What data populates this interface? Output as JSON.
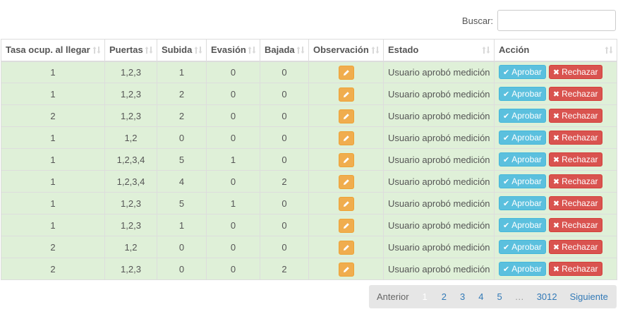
{
  "search": {
    "label": "Buscar:",
    "value": "",
    "placeholder": ""
  },
  "table": {
    "headers": [
      "Tasa ocup. al llegar",
      "Puertas",
      "Subida",
      "Evasión",
      "Bajada",
      "Observación",
      "Estado",
      "Acción"
    ],
    "actions": {
      "approve": "Aprobar",
      "reject": "Rechazar"
    },
    "rows": [
      {
        "tasa": "1",
        "puertas": "1,2,3",
        "subida": "1",
        "evasion": "0",
        "bajada": "0",
        "estado": "Usuario aprobó medición"
      },
      {
        "tasa": "1",
        "puertas": "1,2,3",
        "subida": "2",
        "evasion": "0",
        "bajada": "0",
        "estado": "Usuario aprobó medición"
      },
      {
        "tasa": "2",
        "puertas": "1,2,3",
        "subida": "2",
        "evasion": "0",
        "bajada": "0",
        "estado": "Usuario aprobó medición"
      },
      {
        "tasa": "1",
        "puertas": "1,2",
        "subida": "0",
        "evasion": "0",
        "bajada": "0",
        "estado": "Usuario aprobó medición"
      },
      {
        "tasa": "1",
        "puertas": "1,2,3,4",
        "subida": "5",
        "evasion": "1",
        "bajada": "0",
        "estado": "Usuario aprobó medición"
      },
      {
        "tasa": "1",
        "puertas": "1,2,3,4",
        "subida": "4",
        "evasion": "0",
        "bajada": "2",
        "estado": "Usuario aprobó medición"
      },
      {
        "tasa": "1",
        "puertas": "1,2,3",
        "subida": "5",
        "evasion": "1",
        "bajada": "0",
        "estado": "Usuario aprobó medición"
      },
      {
        "tasa": "1",
        "puertas": "1,2,3",
        "subida": "1",
        "evasion": "0",
        "bajada": "0",
        "estado": "Usuario aprobó medición"
      },
      {
        "tasa": "2",
        "puertas": "1,2",
        "subida": "0",
        "evasion": "0",
        "bajada": "0",
        "estado": "Usuario aprobó medición"
      },
      {
        "tasa": "2",
        "puertas": "1,2,3",
        "subida": "0",
        "evasion": "0",
        "bajada": "2",
        "estado": "Usuario aprobó medición"
      }
    ]
  },
  "pagination": {
    "previous": "Anterior",
    "current": "1",
    "pages": [
      "2",
      "3",
      "4",
      "5"
    ],
    "ellipsis": "…",
    "last": "3012",
    "next": "Siguiente"
  },
  "colors": {
    "row_bg": "#dff0d8",
    "approve": "#5bc0de",
    "reject": "#d9534f",
    "edit": "#f0ad4e",
    "link": "#337ab7"
  },
  "icons": {
    "sort": "sort-arrows-icon",
    "edit": "pencil-icon",
    "approve": "check-icon",
    "reject": "x-icon"
  }
}
